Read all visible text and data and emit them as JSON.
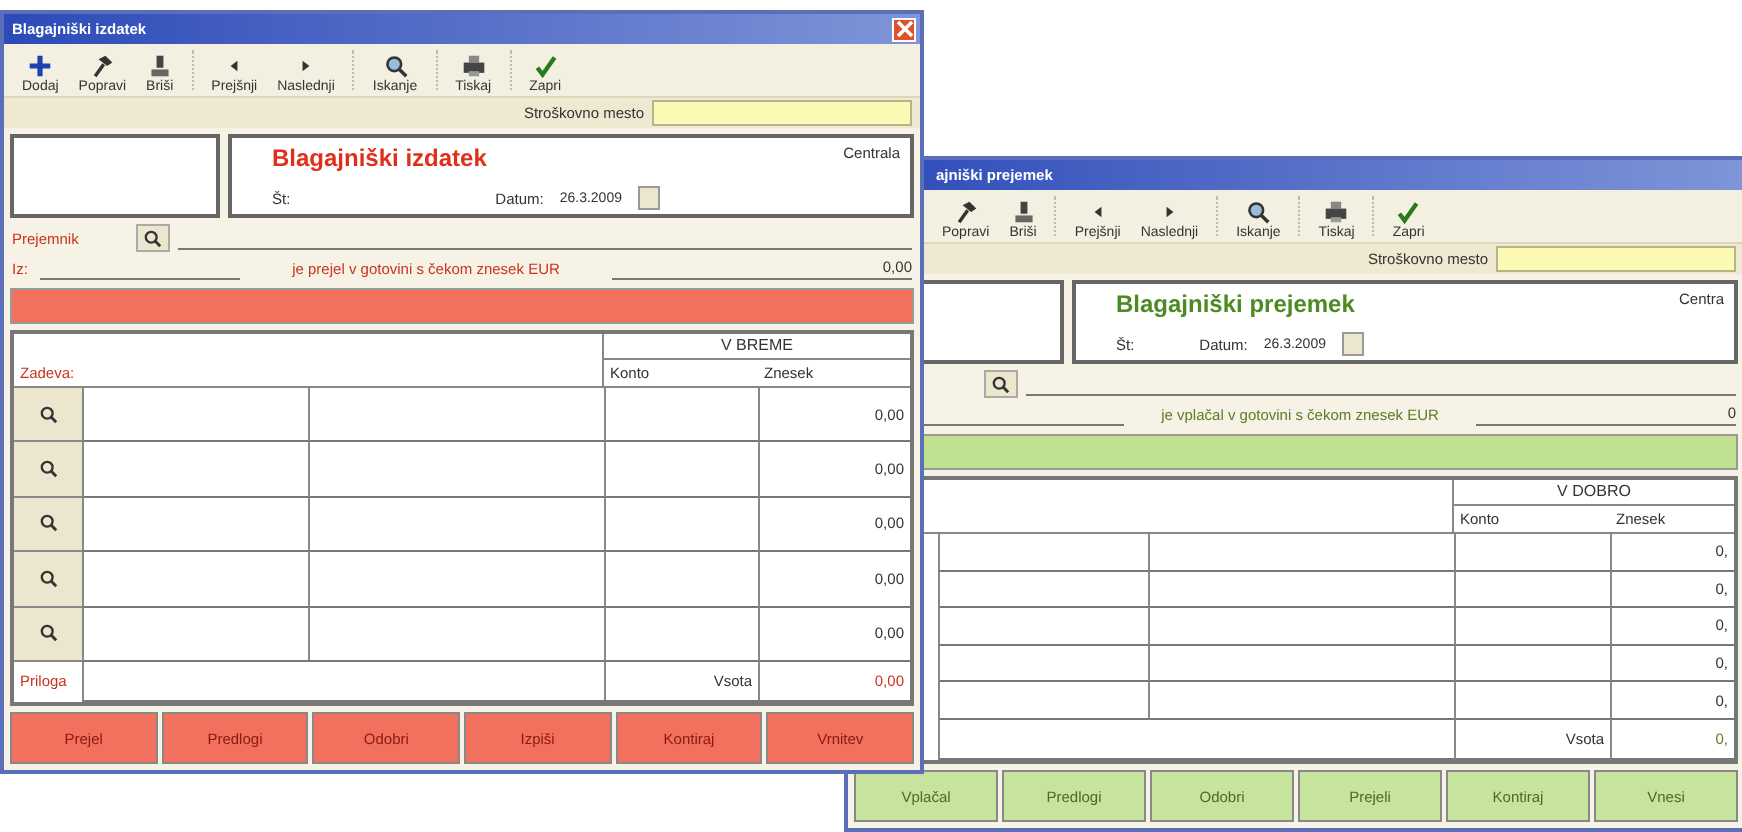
{
  "windows": [
    {
      "kind": "issue",
      "title": "Blagajniški izdatek",
      "toolbar": [
        {
          "kind": "add",
          "label": "Dodaj"
        },
        {
          "kind": "edit",
          "label": "Popravi"
        },
        {
          "kind": "delete",
          "label": "Briši"
        },
        {
          "kind": "prev",
          "label": "Prejšnji"
        },
        {
          "kind": "next",
          "label": "Naslednji"
        },
        {
          "kind": "search",
          "label": "Iskanje"
        },
        {
          "kind": "print",
          "label": "Tiskaj"
        },
        {
          "kind": "close",
          "label": "Zapri"
        }
      ],
      "cost_center_label": "Stroškovno mesto",
      "doc_title": "Blagajniški izdatek",
      "location": "Centrala",
      "number_label": "Št:",
      "date_label": "Datum:",
      "date": "26.3.2009",
      "party_label": "Prejemnik",
      "from_label": "Iz:",
      "amount_text": "je prejel v gotovini s čekom znesek EUR",
      "amount": "0,00",
      "side_title": "V BREME",
      "columns": [
        "Konto",
        "Znesek"
      ],
      "purpose_label": "Zadeva:",
      "rows": [
        {
          "amount": "0,00"
        },
        {
          "amount": "0,00"
        },
        {
          "amount": "0,00"
        },
        {
          "amount": "0,00"
        },
        {
          "amount": "0,00"
        }
      ],
      "attachment_label": "Priloga",
      "total_label": "Vsota",
      "total": "0,00",
      "buttons": [
        "Prejel",
        "Predlogi",
        "Odobri",
        "Izpiši",
        "Kontiraj",
        "Vrnitev"
      ]
    },
    {
      "kind": "receipt",
      "title": "ajniški prejemek",
      "toolbar": [
        {
          "kind": "edit",
          "label": "Popravi"
        },
        {
          "kind": "delete",
          "label": "Briši"
        },
        {
          "kind": "prev",
          "label": "Prejšnji"
        },
        {
          "kind": "next",
          "label": "Naslednji"
        },
        {
          "kind": "search",
          "label": "Iskanje"
        },
        {
          "kind": "print",
          "label": "Tiskaj"
        },
        {
          "kind": "close",
          "label": "Zapri"
        }
      ],
      "cost_center_label": "Stroškovno mesto",
      "doc_title": "Blagajniški prejemek",
      "location": "Centra",
      "number_label": "Št:",
      "date_label": "Datum:",
      "date": "26.3.2009",
      "amount_text": "je vplačal v gotovini s čekom znesek EUR",
      "amount": "0",
      "side_title": "V DOBRO",
      "columns": [
        "Konto",
        "Znesek"
      ],
      "rows": [
        {
          "amount": "0,"
        },
        {
          "amount": "0,"
        },
        {
          "amount": "0,"
        },
        {
          "amount": "0,"
        },
        {
          "amount": "0,"
        }
      ],
      "total_label": "Vsota",
      "total": "0,",
      "buttons": [
        "Vplačal",
        "Predlogi",
        "Odobri",
        "Prejeli",
        "Kontiraj",
        "Vnesi"
      ]
    }
  ]
}
